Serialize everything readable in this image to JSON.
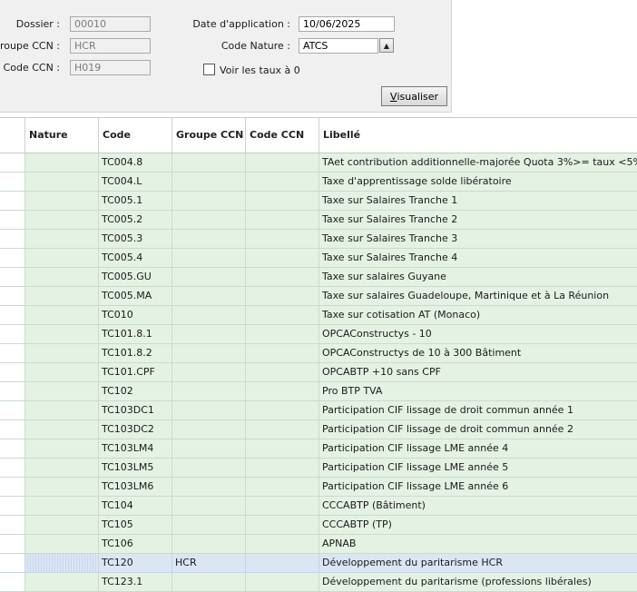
{
  "filters": {
    "dossier_label": "Dossier :",
    "dossier_value": "00010",
    "groupe_ccn_label": "Groupe CCN :",
    "groupe_ccn_value": "HCR",
    "code_ccn_label": "Code CCN :",
    "code_ccn_value": "H019",
    "date_label": "Date d'application :",
    "date_value": "10/06/2025",
    "code_nature_label": "Code Nature :",
    "code_nature_value": "ATCS",
    "voir_taux_label": "Voir les taux à 0",
    "voir_taux_checked": false,
    "visualiser_first": "V",
    "visualiser_rest": "isualiser"
  },
  "grid": {
    "headers": [
      "",
      "Nature",
      "Code",
      "Groupe CCN",
      "Code CCN",
      "Libellé"
    ],
    "rows": [
      {
        "nature": "",
        "code": "TC004.8",
        "groupe": "",
        "ccn": "",
        "libelle": "TAet contribution additionnelle-majorée Quota 3%>= taux <5%"
      },
      {
        "nature": "",
        "code": "TC004.L",
        "groupe": "",
        "ccn": "",
        "libelle": "Taxe d'apprentissage solde libératoire"
      },
      {
        "nature": "",
        "code": "TC005.1",
        "groupe": "",
        "ccn": "",
        "libelle": "Taxe sur Salaires Tranche 1"
      },
      {
        "nature": "",
        "code": "TC005.2",
        "groupe": "",
        "ccn": "",
        "libelle": "Taxe sur Salaires Tranche 2"
      },
      {
        "nature": "",
        "code": "TC005.3",
        "groupe": "",
        "ccn": "",
        "libelle": "Taxe sur Salaires Tranche 3"
      },
      {
        "nature": "",
        "code": "TC005.4",
        "groupe": "",
        "ccn": "",
        "libelle": "Taxe sur Salaires Tranche 4"
      },
      {
        "nature": "",
        "code": "TC005.GU",
        "groupe": "",
        "ccn": "",
        "libelle": "Taxe sur salaires Guyane"
      },
      {
        "nature": "",
        "code": "TC005.MA",
        "groupe": "",
        "ccn": "",
        "libelle": "Taxe sur salaires Guadeloupe, Martinique et à La Réunion"
      },
      {
        "nature": "",
        "code": "TC010",
        "groupe": "",
        "ccn": "",
        "libelle": "Taxe sur cotisation AT (Monaco)"
      },
      {
        "nature": "",
        "code": "TC101.8.1",
        "groupe": "",
        "ccn": "",
        "libelle": "OPCAConstructys - 10"
      },
      {
        "nature": "",
        "code": "TC101.8.2",
        "groupe": "",
        "ccn": "",
        "libelle": "OPCAConstructys de 10 à 300 Bâtiment"
      },
      {
        "nature": "",
        "code": "TC101.CPF",
        "groupe": "",
        "ccn": "",
        "libelle": "OPCABTP +10 sans CPF"
      },
      {
        "nature": "",
        "code": "TC102",
        "groupe": "",
        "ccn": "",
        "libelle": "Pro BTP TVA"
      },
      {
        "nature": "",
        "code": "TC103DC1",
        "groupe": "",
        "ccn": "",
        "libelle": "Participation CIF lissage de droit commun année 1"
      },
      {
        "nature": "",
        "code": "TC103DC2",
        "groupe": "",
        "ccn": "",
        "libelle": "Participation CIF lissage de droit commun année 2"
      },
      {
        "nature": "",
        "code": "TC103LM4",
        "groupe": "",
        "ccn": "",
        "libelle": "Participation CIF lissage LME année 4"
      },
      {
        "nature": "",
        "code": "TC103LM5",
        "groupe": "",
        "ccn": "",
        "libelle": "Participation CIF lissage LME année 5"
      },
      {
        "nature": "",
        "code": "TC103LM6",
        "groupe": "",
        "ccn": "",
        "libelle": "Participation CIF lissage LME année 6"
      },
      {
        "nature": "",
        "code": "TC104",
        "groupe": "",
        "ccn": "",
        "libelle": "CCCABTP (Bâtiment)"
      },
      {
        "nature": "",
        "code": "TC105",
        "groupe": "",
        "ccn": "",
        "libelle": "CCCABTP (TP)"
      },
      {
        "nature": "",
        "code": "TC106",
        "groupe": "",
        "ccn": "",
        "libelle": "APNAB"
      },
      {
        "nature": "",
        "code": "TC120",
        "groupe": "HCR",
        "ccn": "",
        "libelle": "Développement du paritarisme HCR",
        "selected": true
      },
      {
        "nature": "",
        "code": "TC123.1",
        "groupe": "",
        "ccn": "",
        "libelle": "Développement du paritarisme (professions libérales)"
      }
    ]
  }
}
